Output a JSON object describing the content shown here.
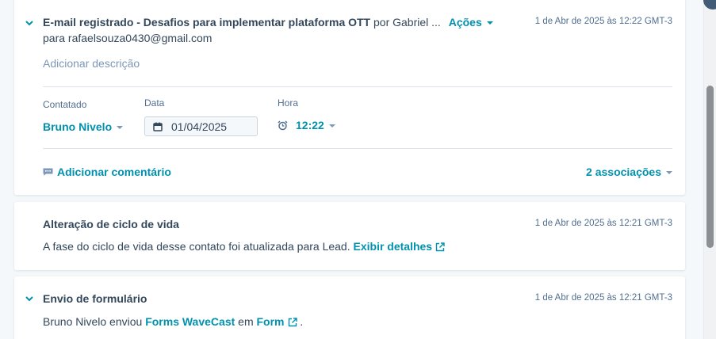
{
  "email": {
    "title_bold": "E-mail registrado - Desafios para implementar plataforma OTT",
    "title_rest": " por Gabriel ...",
    "actions_label": "Ações",
    "timestamp": "1 de Abr de 2025 às 12:22 GMT-3",
    "recipient": "para rafaelsouza0430@gmail.com",
    "add_description": "Adicionar descrição",
    "contacted_label": "Contatado",
    "contacted_value": "Bruno Nivelo",
    "date_label": "Data",
    "date_value": "01/04/2025",
    "time_label": "Hora",
    "time_value": "12:22",
    "add_comment": "Adicionar comentário",
    "associations": "2 associações"
  },
  "lifecycle": {
    "title": "Alteração de ciclo de vida",
    "timestamp": "1 de Abr de 2025 às 12:21 GMT-3",
    "text": "A fase do ciclo de vida desse contato foi atualizada para Lead.",
    "details_link": "Exibir detalhes"
  },
  "form": {
    "title": "Envio de formulário",
    "timestamp": "1 de Abr de 2025 às 12:21 GMT-3",
    "text_prefix": "Bruno Nivelo enviou",
    "form_name": "Forms WaveCast",
    "text_mid": "em",
    "form_link": "Form",
    "text_suffix": "."
  },
  "colors": {
    "link": "#0091ae",
    "text": "#33475b",
    "muted": "#7c98b6"
  }
}
